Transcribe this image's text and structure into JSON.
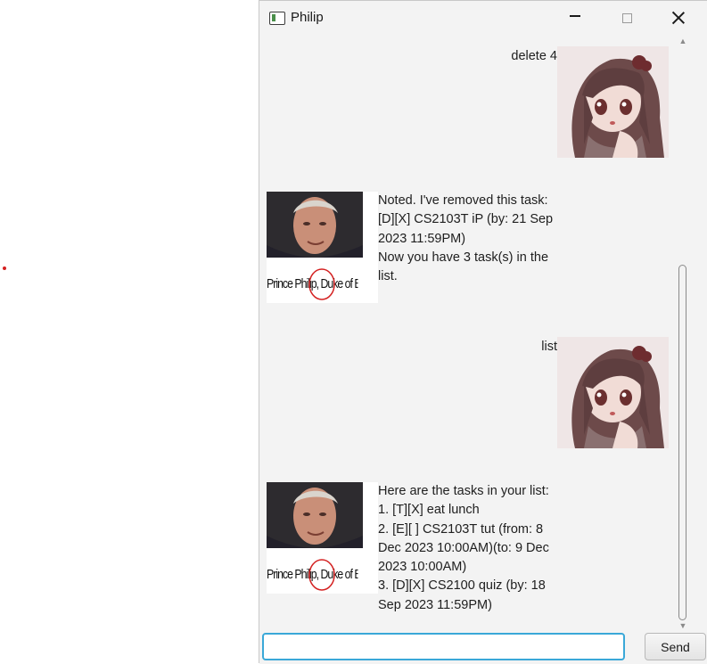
{
  "window": {
    "title": "Philip",
    "controls": {
      "minimize": "minimize",
      "maximize": "maximize",
      "close": "close"
    }
  },
  "messages": [
    {
      "sender": "user",
      "text": "delete 4",
      "avatar": "anime-girl-avatar"
    },
    {
      "sender": "bot",
      "lines": [
        "Noted. I've removed this task:",
        "[D][X] CS2103T iP (by: 21 Sep",
        "2023 11:59PM)",
        "Now you have 3 task(s) in the",
        "list."
      ],
      "avatar": "prince-philip-avatar",
      "caption": "Prince Philip, Duke of Edinburgh"
    },
    {
      "sender": "user",
      "text": "list",
      "avatar": "anime-girl-avatar"
    },
    {
      "sender": "bot",
      "lines": [
        "Here are the tasks in your list:",
        "1. [T][X] eat lunch",
        "2. [E][ ] CS2103T tut (from: 8",
        "Dec 2023 10:00AM)(to: 9 Dec",
        "2023 10:00AM)",
        "3. [D][X] CS2100 quiz (by: 18",
        "Sep 2023 11:59PM)"
      ],
      "avatar": "prince-philip-avatar",
      "caption": "Prince Philip, Duke of Edinburgh"
    }
  ],
  "input": {
    "value": "",
    "placeholder": ""
  },
  "send_button": {
    "label": "Send"
  },
  "colors": {
    "input_focus": "#3aa8d8",
    "window_bg": "#f3f3f3",
    "dot": "#d42020"
  }
}
